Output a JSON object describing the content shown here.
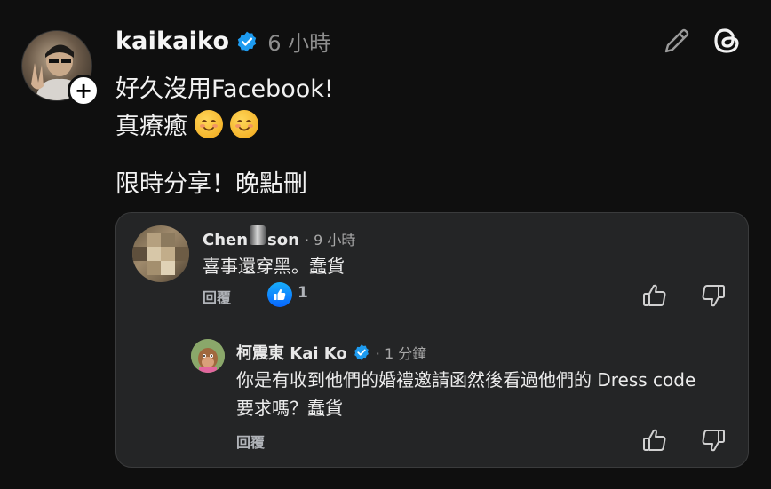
{
  "post": {
    "username": "kaikaiko",
    "time": "6 小時",
    "line1": "好久沒用Facebook!",
    "line2_text": "真療癒",
    "line2_emojis": [
      "smiling-face-emoji",
      "smiling-face-emoji"
    ],
    "line3": "限時分享！晚點刪"
  },
  "comment": {
    "name_start": "Chen",
    "name_end": "son",
    "time": "· 9 小時",
    "text": "喜事還穿黑。蠢貨",
    "reply_label": "回覆",
    "like_count": "1"
  },
  "reply": {
    "name": "柯震東 Kai Ko",
    "time": "· 1 分鐘",
    "text": "你是有收到他們的婚禮邀請函然後看過他們的 Dress code 要求嗎？蠢貨",
    "reply_label": "回覆"
  },
  "colors": {
    "background": "#0f0f0f",
    "card": "#242526",
    "verified": "#1d9bf0",
    "like": "#0866ff"
  }
}
